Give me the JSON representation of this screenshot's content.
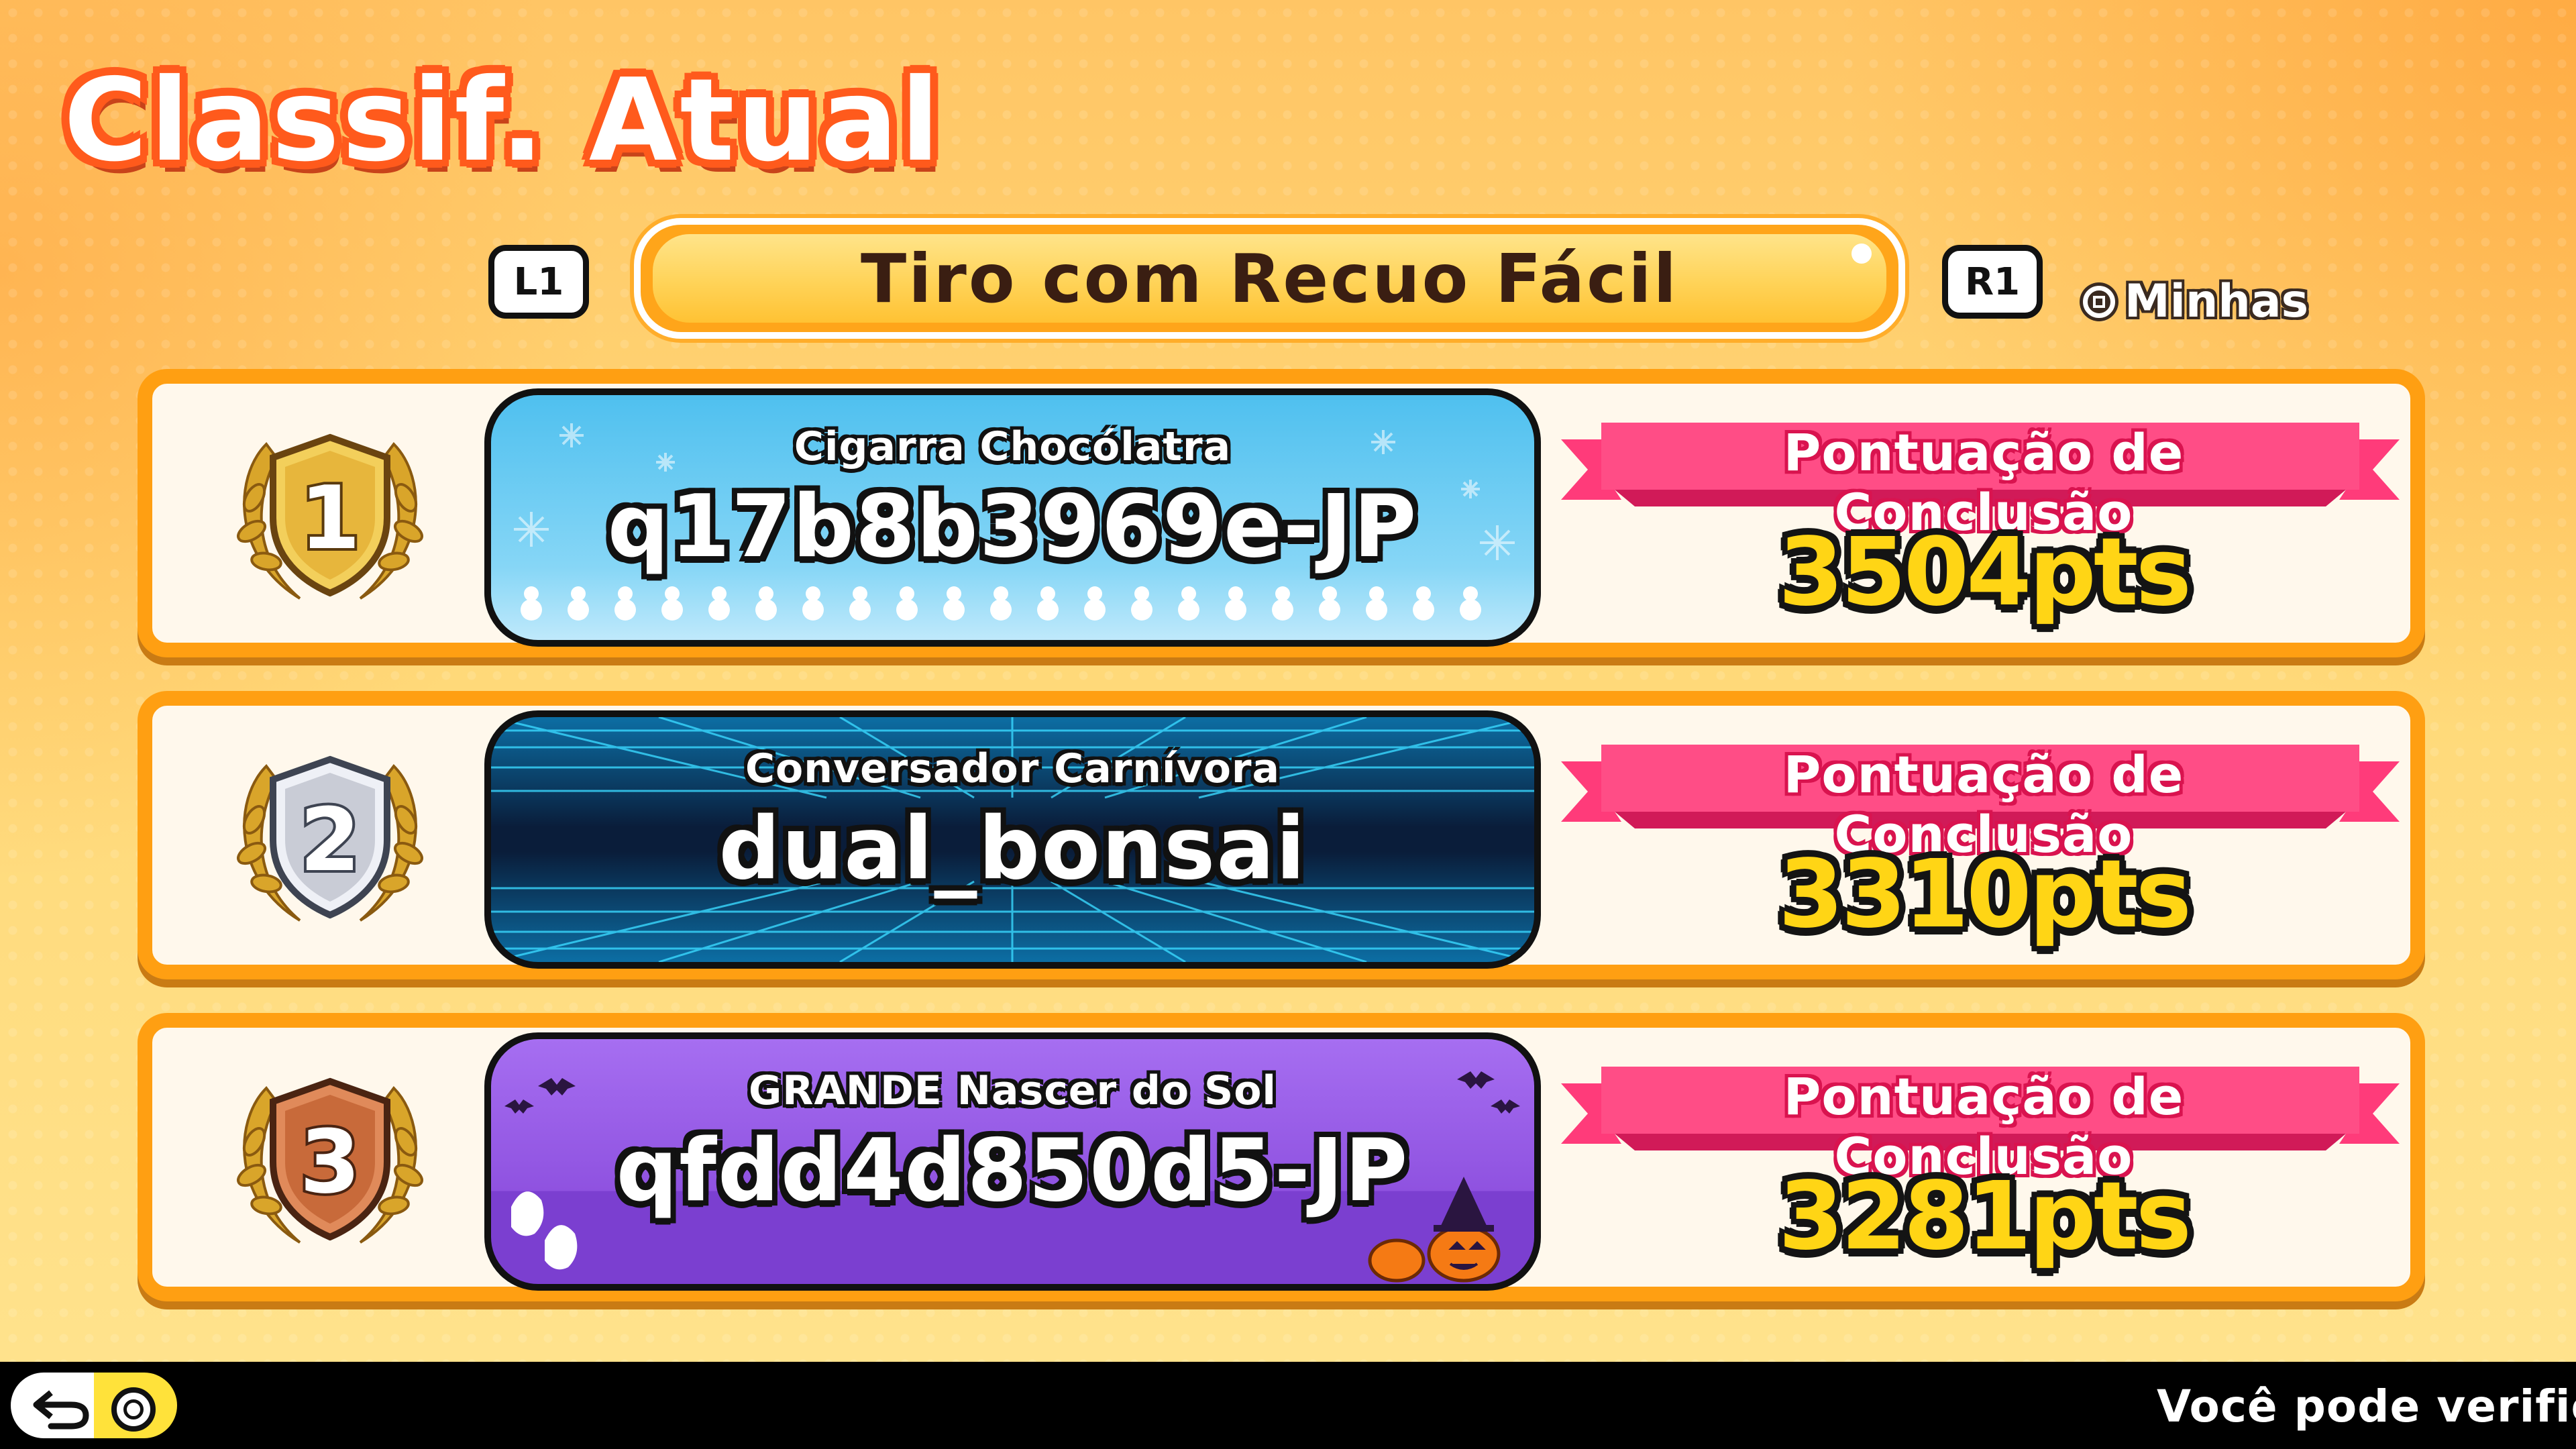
{
  "header": {
    "title": "Classif. Atual",
    "left_key": "L1",
    "right_key": "R1",
    "course_name": "Tiro com Recuo Fácil",
    "mine_label": "Minhas"
  },
  "rows": [
    {
      "rank": "1",
      "subtitle": "Cigarra Chocólatra",
      "player": "q17b8b3969e-JP",
      "score_label": "Pontuação de Conclusão",
      "score": "3504pts",
      "card_theme": "snow"
    },
    {
      "rank": "2",
      "subtitle": "Conversador Carnívora",
      "player": "dual_bonsai",
      "score_label": "Pontuação de Conclusão",
      "score": "3310pts",
      "card_theme": "grid"
    },
    {
      "rank": "3",
      "subtitle": "GRANDE Nascer do Sol",
      "player": "qfdd4d850d5-JP",
      "score_label": "Pontuação de Conclusão",
      "score": "3281pts",
      "card_theme": "halloween"
    }
  ],
  "footer": {
    "hint": "Você pode verific",
    "back_icon": "back-arrow-icon",
    "confirm_icon": "circle-button-icon"
  },
  "colors": {
    "title_outline": "#ff5a1c",
    "row_border": "#ff9f12",
    "ribbon": "#ff3b7a",
    "score_fill": "#ffd515",
    "gold": "#e8b53a",
    "silver": "#c9ccd6",
    "bronze": "#c86a3a"
  }
}
